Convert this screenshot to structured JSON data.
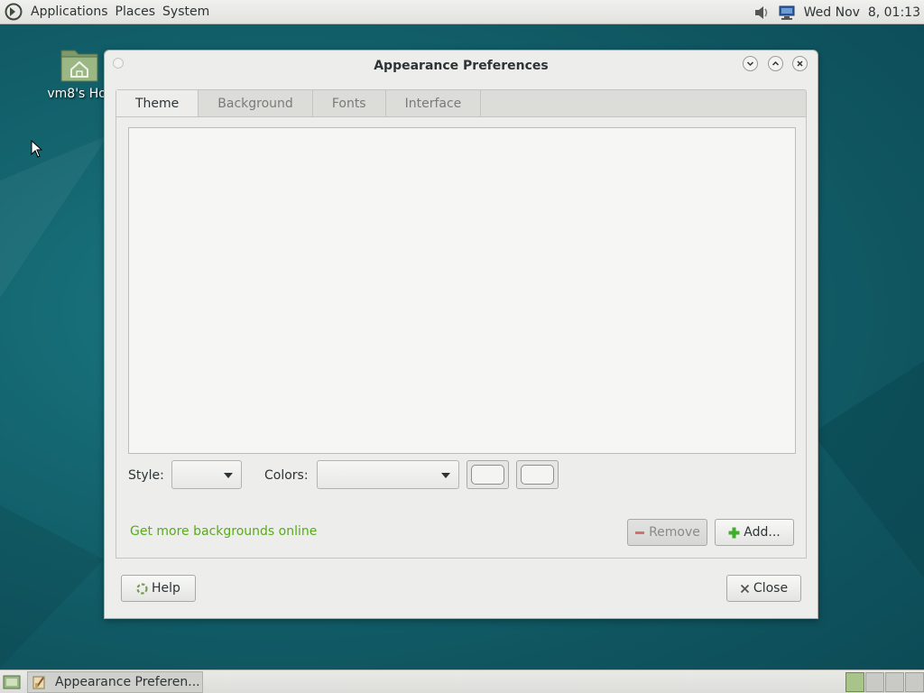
{
  "top_panel": {
    "menus": [
      "Applications",
      "Places",
      "System"
    ],
    "clock": "Wed Nov  8, 01:13"
  },
  "desktop": {
    "home_icon_label": "vm8's Hor"
  },
  "window": {
    "title": "Appearance Preferences",
    "tabs": [
      "Theme",
      "Background",
      "Fonts",
      "Interface"
    ],
    "active_tab": "Theme",
    "style_label": "Style:",
    "colors_label": "Colors:",
    "style_value": "",
    "colors_value": "",
    "link_text": "Get more backgrounds online",
    "remove_label": "Remove",
    "add_label": "Add...",
    "help_label": "Help",
    "close_label": "Close"
  },
  "taskbar": {
    "task_label": "Appearance Preferen..."
  },
  "colors": {
    "link": "#5aaa1d",
    "desktop": "#146670",
    "active_workspace": "#a9c48a"
  },
  "icons": {
    "menu_logo": "distro-logo-icon",
    "volume": "speaker-icon",
    "network": "network-icon",
    "home_folder": "home-folder-icon",
    "remove": "minus-icon",
    "add": "plus-icon",
    "help": "lifebuoy-icon",
    "close": "x-icon"
  }
}
